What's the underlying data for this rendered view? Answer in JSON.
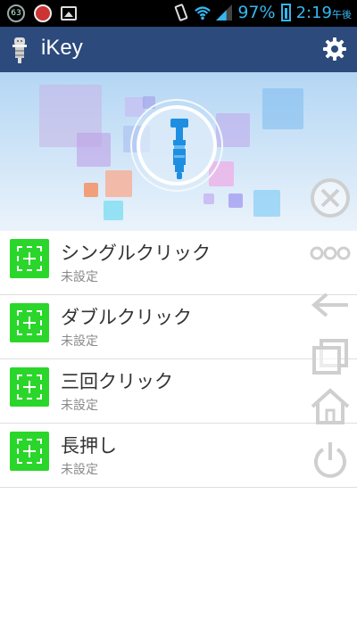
{
  "status_bar": {
    "notification_badge": "63",
    "battery": "97%",
    "time": "2:19",
    "time_suffix": "午後"
  },
  "app_bar": {
    "title": "iKey",
    "settings_icon": "gear-icon"
  },
  "hero": {
    "center_icon": "headphone-jack-plug-icon"
  },
  "actions": [
    {
      "title": "シングルクリック",
      "status": "未設定",
      "icon": "add-icon"
    },
    {
      "title": "ダブルクリック",
      "status": "未設定",
      "icon": "add-icon"
    },
    {
      "title": "三回クリック",
      "status": "未設定",
      "icon": "add-icon"
    },
    {
      "title": "長押し",
      "status": "未設定",
      "icon": "add-icon"
    }
  ],
  "floating_menu": {
    "items": [
      "close-icon",
      "more-icon",
      "back-icon",
      "recent-apps-icon",
      "home-icon",
      "power-icon"
    ]
  },
  "colors": {
    "app_bar": "#2c4a7c",
    "add_button": "#2bd62b",
    "accent_blue": "#35b6f0"
  }
}
